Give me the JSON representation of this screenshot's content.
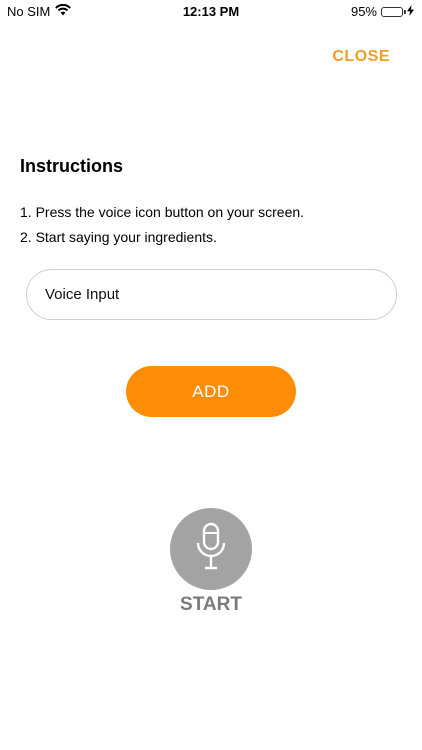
{
  "status_bar": {
    "carrier": "No SIM",
    "time": "12:13 PM",
    "battery_percent": "95%",
    "battery_level": 0.95,
    "battery_color": "#2ecc40"
  },
  "header": {
    "close_label": "CLOSE",
    "accent_color": "#f39c28"
  },
  "instructions": {
    "title": "Instructions",
    "steps": [
      "1. Press the voice icon button on your screen.",
      "2. Start saying your ingredients."
    ]
  },
  "voice_input": {
    "value": "",
    "placeholder": "Voice Input"
  },
  "add_button": {
    "label": "ADD",
    "color": "#ff8c06"
  },
  "mic": {
    "icon": "microphone-icon",
    "label": "START",
    "color": "#a3a3a3"
  }
}
